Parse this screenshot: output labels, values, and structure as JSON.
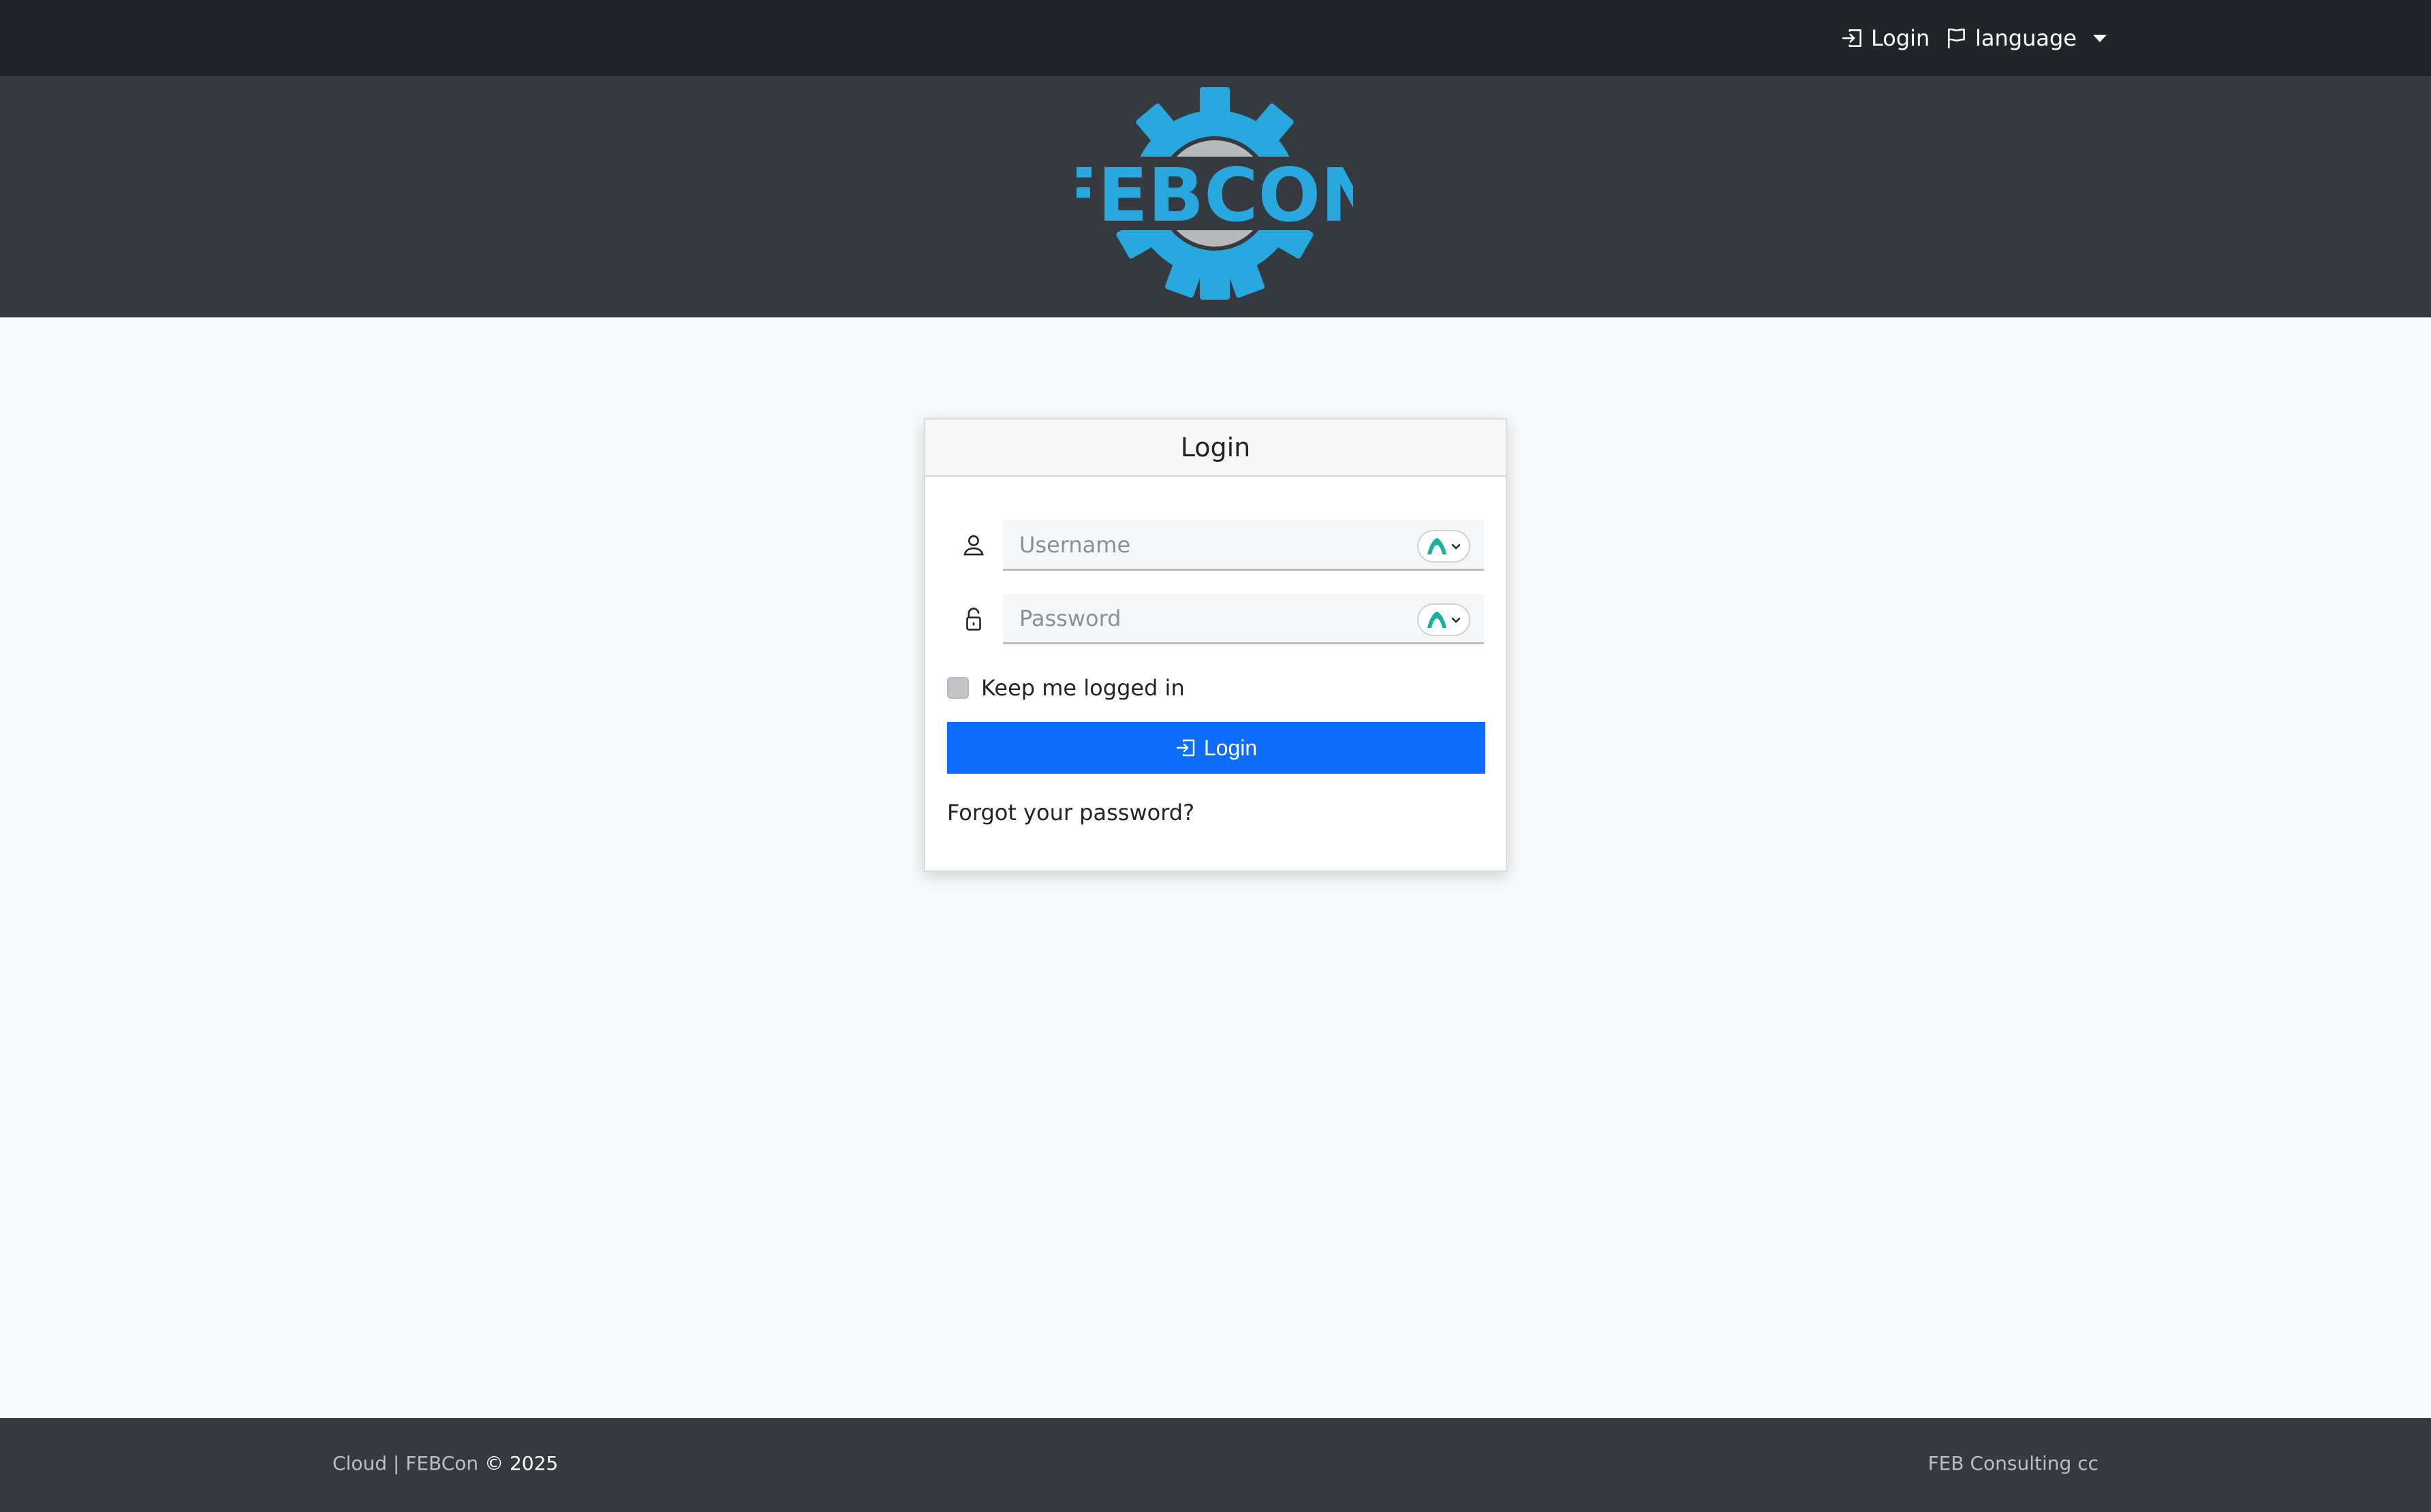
{
  "nav": {
    "login_label": "Login",
    "language_label": "language",
    "login_icon": "box-arrow-in-right-icon",
    "language_icon": "flag-icon"
  },
  "brand": {
    "logo_text": "FEBCON",
    "logo_color": "#29a8e0"
  },
  "login_card": {
    "title": "Login",
    "username": {
      "value": "",
      "placeholder": "Username",
      "icon": "person-icon"
    },
    "password": {
      "value": "",
      "placeholder": "Password",
      "icon": "lock-icon"
    },
    "remember_label": "Keep me logged in",
    "remember_checked": false,
    "submit_label": "Login",
    "forgot_label": "Forgot your password?"
  },
  "footer": {
    "left_text": "Cloud | FEBCon",
    "copyright": "© 2025",
    "right_text": "FEB Consulting cc"
  },
  "colors": {
    "navbar": "#212529",
    "banner": "#343a40",
    "primary": "#0d6efd",
    "page_bg": "#f8f9fa"
  }
}
